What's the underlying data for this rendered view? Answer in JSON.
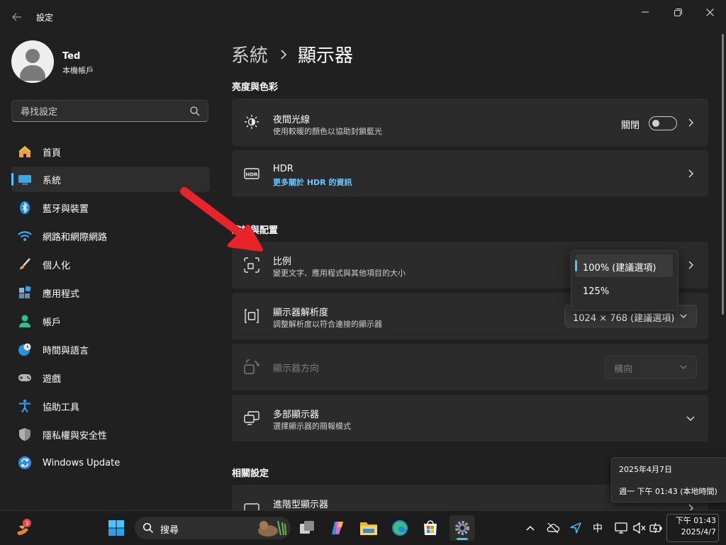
{
  "app": {
    "title": "設定"
  },
  "window": {
    "minimize": "—",
    "restore": "❐",
    "close": "✕"
  },
  "user": {
    "name": "Ted",
    "account": "本機帳戶"
  },
  "search": {
    "placeholder": "尋找設定"
  },
  "nav": {
    "items": [
      {
        "label": "首頁",
        "icon": "home-icon"
      },
      {
        "label": "系統",
        "icon": "monitor-icon",
        "selected": true
      },
      {
        "label": "藍牙與裝置",
        "icon": "bluetooth-icon"
      },
      {
        "label": "網路和網際網路",
        "icon": "wifi-icon"
      },
      {
        "label": "個人化",
        "icon": "brush-icon"
      },
      {
        "label": "應用程式",
        "icon": "apps-icon"
      },
      {
        "label": "帳戶",
        "icon": "account-icon"
      },
      {
        "label": "時間與語言",
        "icon": "clock-globe-icon"
      },
      {
        "label": "遊戲",
        "icon": "gamepad-icon"
      },
      {
        "label": "協助工具",
        "icon": "accessibility-icon"
      },
      {
        "label": "隱私權與安全性",
        "icon": "shield-icon"
      },
      {
        "label": "Windows Update",
        "icon": "update-icon"
      }
    ]
  },
  "breadcrumb": {
    "parent": "系統",
    "current": "顯示器"
  },
  "sections": {
    "brightness": "亮度與色彩",
    "scale_layout": "縮放與配置",
    "related": "相關設定"
  },
  "cards": {
    "night_light": {
      "title": "夜間光線",
      "subtitle": "使用較暖的顏色以協助封鎖藍光",
      "toggle_label": "關閉",
      "toggle_on": false
    },
    "hdr": {
      "title": "HDR",
      "link": "更多關於 HDR 的資訊"
    },
    "scale": {
      "title": "比例",
      "subtitle": "變更文字、應用程式與其他項目的大小"
    },
    "resolution": {
      "title": "顯示器解析度",
      "subtitle": "調整解析度以符合連接的顯示器",
      "value": "1024 × 768 (建議選項)"
    },
    "orientation": {
      "title": "顯示器方向",
      "value": "橫向",
      "disabled": true
    },
    "multi": {
      "title": "多部顯示器",
      "subtitle": "選擇顯示器的簡報模式"
    },
    "advanced": {
      "title": "進階型顯示器"
    }
  },
  "scale_options": {
    "selected": "100% (建議選項)",
    "other": "125%"
  },
  "date_tooltip": {
    "line1": "2025年4月7日",
    "line2": "週一 下午 01:43 (本地時間)"
  },
  "taskbar": {
    "search_label": "搜尋",
    "widget_badge": "3",
    "tray_lang": "中",
    "clock_time": "下午 01:43",
    "clock_date": "2025/4/7"
  },
  "colors": {
    "accent": "#4cc2ff",
    "arrow": "#e8232a",
    "background": "#202020",
    "card": "#2b2b2b"
  }
}
